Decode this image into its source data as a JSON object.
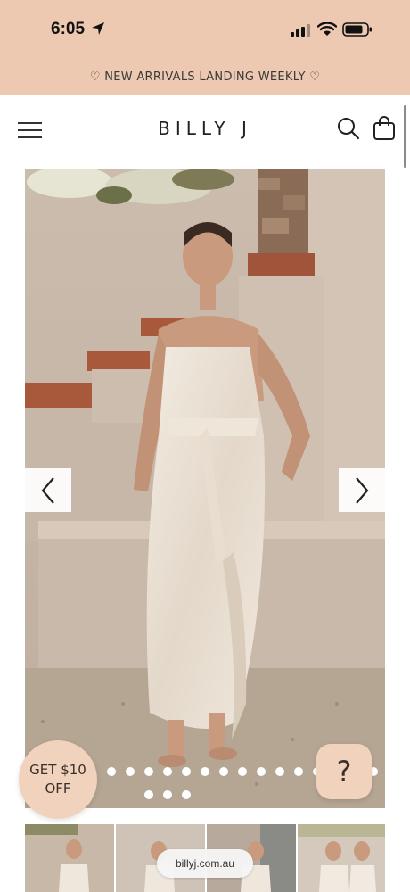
{
  "status_bar": {
    "time": "6:05"
  },
  "promo": {
    "text": "♡ NEW ARRIVALS LANDING WEEKLY ♡"
  },
  "header": {
    "brand": "BILLY J"
  },
  "carousel": {
    "dot_count": 18
  },
  "offer": {
    "line1": "GET $10",
    "line2": "OFF"
  },
  "help": {
    "glyph": "?"
  },
  "browser": {
    "url": "billyj.com.au"
  },
  "colors": {
    "promo_bg": "#ecc9b0",
    "badge_bg": "#f1d3bd"
  }
}
